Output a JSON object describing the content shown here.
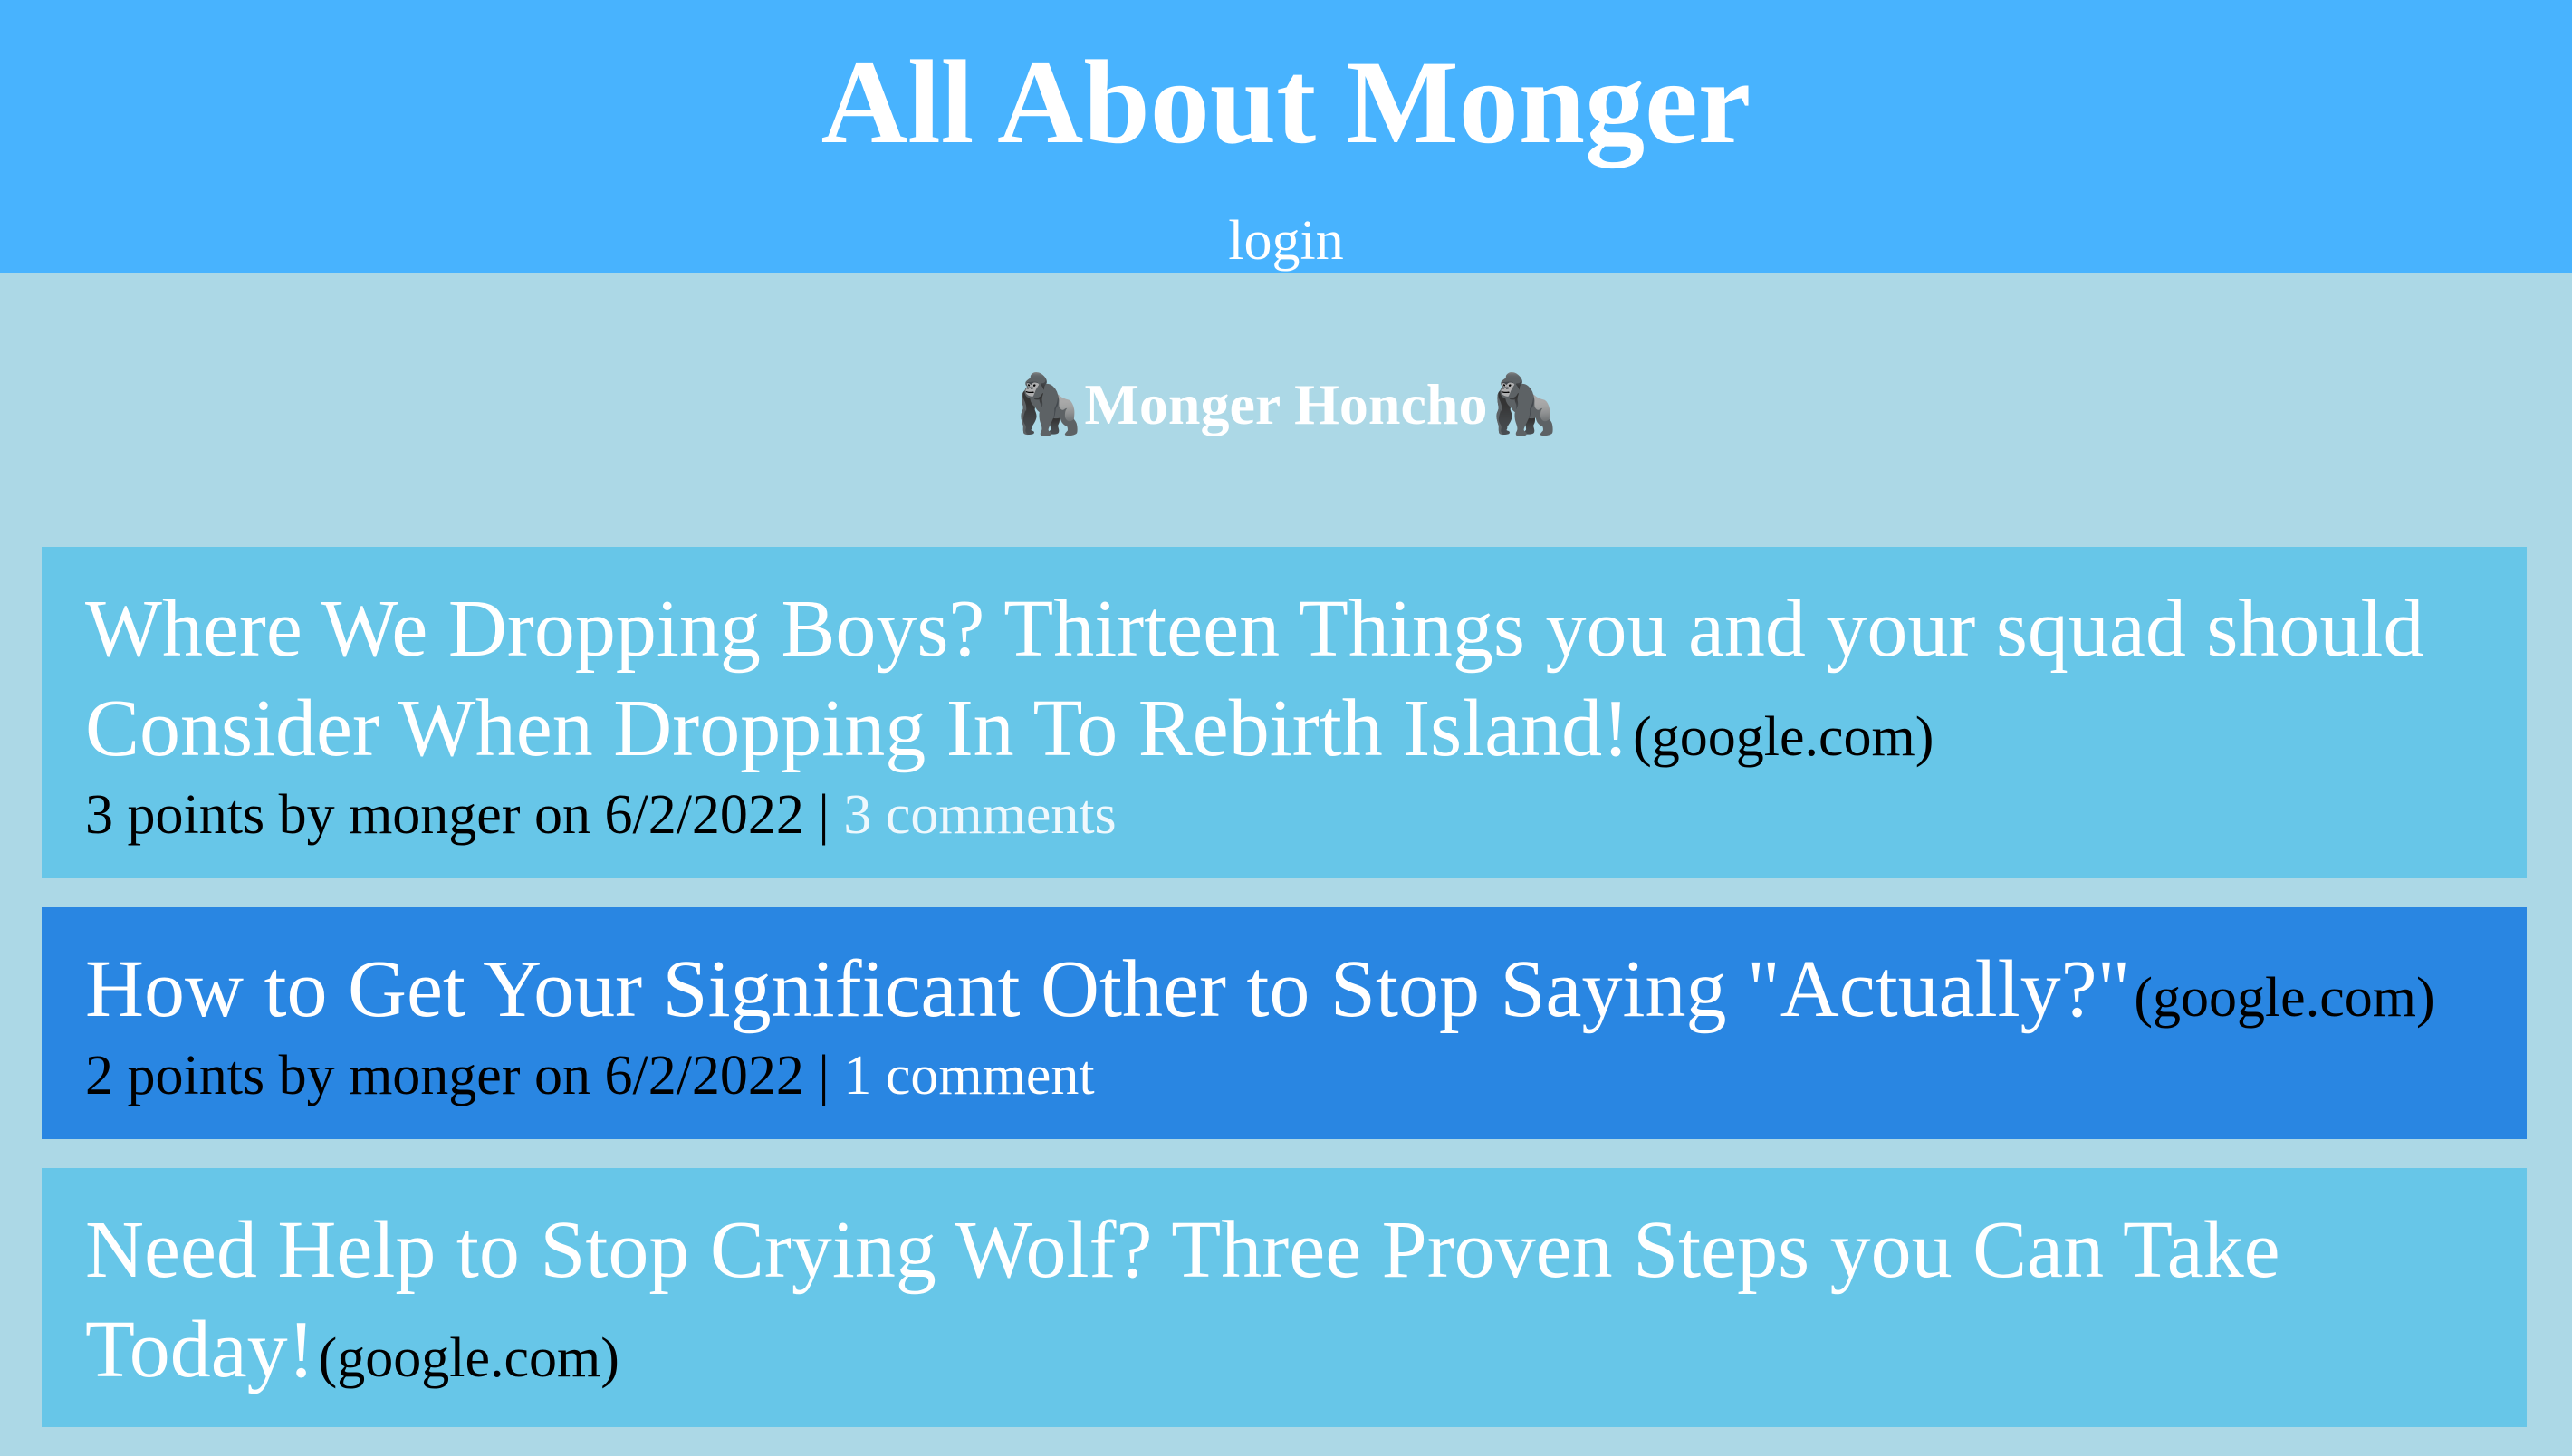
{
  "header": {
    "title": "All About Monger",
    "login_label": "login"
  },
  "honcho": {
    "label": "🦍Monger Honcho🦍"
  },
  "posts": [
    {
      "title": "Where We Dropping Boys? Thirteen Things you and your squad should Consider When Dropping In To Rebirth Island!",
      "domain": "(google.com)",
      "meta": "3 points by monger on 6/2/2022 | ",
      "comments": "3 comments"
    },
    {
      "title": "How to Get Your Significant Other to Stop Saying \"Actually?\"",
      "domain": "(google.com)",
      "meta": "2 points by monger on 6/2/2022 | ",
      "comments": "1 comment"
    },
    {
      "title": "Need Help to Stop Crying Wolf? Three Proven Steps you Can Take Today!",
      "domain": "(google.com)",
      "meta": "",
      "comments": ""
    }
  ],
  "colors": {
    "header_bg": "#48b3fe",
    "page_bg": "#acd8e6",
    "post_light_bg": "#67c6e8",
    "post_dark_bg": "#2986e2"
  }
}
